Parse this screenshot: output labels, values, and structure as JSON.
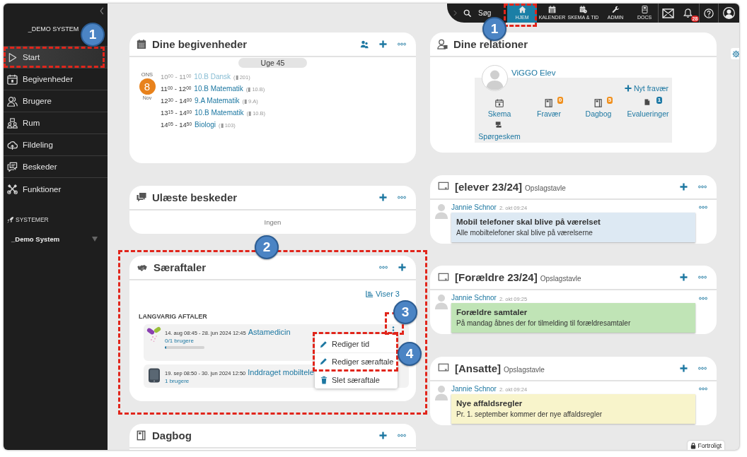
{
  "sidebar": {
    "title": "_DEMO SYSTEM",
    "items": [
      {
        "label": "Start",
        "selected": true,
        "callout": "1"
      },
      {
        "label": "Begivenheder",
        "selected": false
      },
      {
        "label": "Brugere",
        "selected": false
      },
      {
        "label": "Rum",
        "selected": false
      },
      {
        "label": "Fildeling",
        "selected": false
      },
      {
        "label": "Beskeder",
        "selected": false
      },
      {
        "label": "Funktioner",
        "selected": false
      }
    ],
    "section": "SYSTEMER",
    "system_select": {
      "value": "_Demo System"
    }
  },
  "topbar": {
    "search": "Søg",
    "nav": [
      {
        "label": "HJEM",
        "selected": true,
        "callout": "1"
      },
      {
        "label": "KALENDER",
        "selected": false
      },
      {
        "label": "SKEMA & TID",
        "selected": false
      },
      {
        "label": "ADMIN",
        "selected": false
      },
      {
        "label": "DOCS",
        "selected": false
      }
    ],
    "notification_count": "28"
  },
  "left_column": [
    {
      "kind": "events",
      "title": "Dine begivenheder",
      "week": "Uge 45",
      "day": {
        "weekday": "ONS",
        "date": "8",
        "month": "Nov"
      },
      "events": [
        {
          "time": "10$^{00}$ - 11$^{00}$",
          "title": "10.B Dansk",
          "room": "(▮ 201)",
          "past": true
        },
        {
          "time": "11$^{00}$ - 12$^{00}$",
          "title": "10.B Matematik",
          "room": "(▮ 10.B)",
          "past": false
        },
        {
          "time": "12$^{30}$ - 14$^{00}$",
          "title": "9.A Matematik",
          "room": "(▮ 9.A)",
          "past": false
        },
        {
          "time": "13$^{15}$ - 14$^{00}$",
          "title": "10.B Matematik",
          "room": "(▮ 10.B)",
          "past": false
        },
        {
          "time": "14$^{05}$ - 14$^{50}$",
          "title": "Biologi",
          "room": "(▮ 103)",
          "past": false
        }
      ]
    },
    {
      "kind": "messages",
      "title": "Ulæste beskeder",
      "empty_text": "Ingen"
    },
    {
      "kind": "agreements",
      "title": "Særaftaler",
      "callout": "2",
      "filter": "Viser 3",
      "group": "LANGVARIG AFTALER",
      "agreements": [
        {
          "period": "14. aug 08:45 - 28. jun 2024 12:45",
          "title": "Astamedicin",
          "users": "0/1 brugere",
          "level": 0,
          "kebab_callout": "3",
          "menu": {
            "open": true,
            "callout": "4",
            "items": [
              {
                "kind": "edit",
                "label": "Rediger tid",
                "highlighted": true
              },
              {
                "kind": "edit",
                "label": "Rediger særaftale",
                "highlighted": true
              },
              {
                "kind": "delete",
                "label": "Slet særaftale",
                "highlighted": false
              }
            ]
          }
        },
        {
          "period": "19. sep 08:50 - 30. jun 2024 12:50",
          "title": "Inddraget mobiltele",
          "users": "1 brugere"
        }
      ]
    },
    {
      "kind": "diary",
      "title": "Dagbog"
    }
  ],
  "right_column": [
    {
      "kind": "relations",
      "title": "Dine relationer",
      "person": "ViGGO Elev",
      "action": "Nyt fravær",
      "links": [
        {
          "label": "Skema"
        },
        {
          "label": "Fravær",
          "count": "0",
          "color": "#f0901e"
        },
        {
          "label": "Dagbog",
          "count": "5",
          "color": "#f0901e"
        },
        {
          "label": "Evalueringer",
          "count": "1",
          "color": "#1f7aa6"
        },
        {
          "label": "Spørgeskem"
        }
      ]
    },
    {
      "kind": "board",
      "title": "[elever 23/24]",
      "subtitle": "Opslagstavle",
      "posts": [
        {
          "author": "Jannie Schnor",
          "time": "2. okt 09:24",
          "heading": "Mobil telefoner skal blive på værelset",
          "text": "Alle mobiltelefoner skal blive på værelserne",
          "color": "#dde9f3"
        }
      ]
    },
    {
      "kind": "board",
      "title": "[Forældre 23/24]",
      "subtitle": "Opslagstavle",
      "posts": [
        {
          "author": "Jannie Schnor",
          "time": "2. okt 09:25",
          "heading": "Forældre samtaler",
          "text": "På mandag åbnes der for tilmelding til forældresamtaler",
          "color": "#c0e4b6"
        }
      ]
    },
    {
      "kind": "board",
      "title": "[Ansatte]",
      "subtitle": "Opslagstavle",
      "posts": [
        {
          "author": "Jannie Schnor",
          "time": "2. okt 09:24",
          "heading": "Nye affaldsregler",
          "text": "Pr. 1. september kommer der nye affaldsregler",
          "color": "#f8f4cb"
        }
      ]
    }
  ],
  "footer": {
    "confidential_label": "Fortroligt"
  }
}
